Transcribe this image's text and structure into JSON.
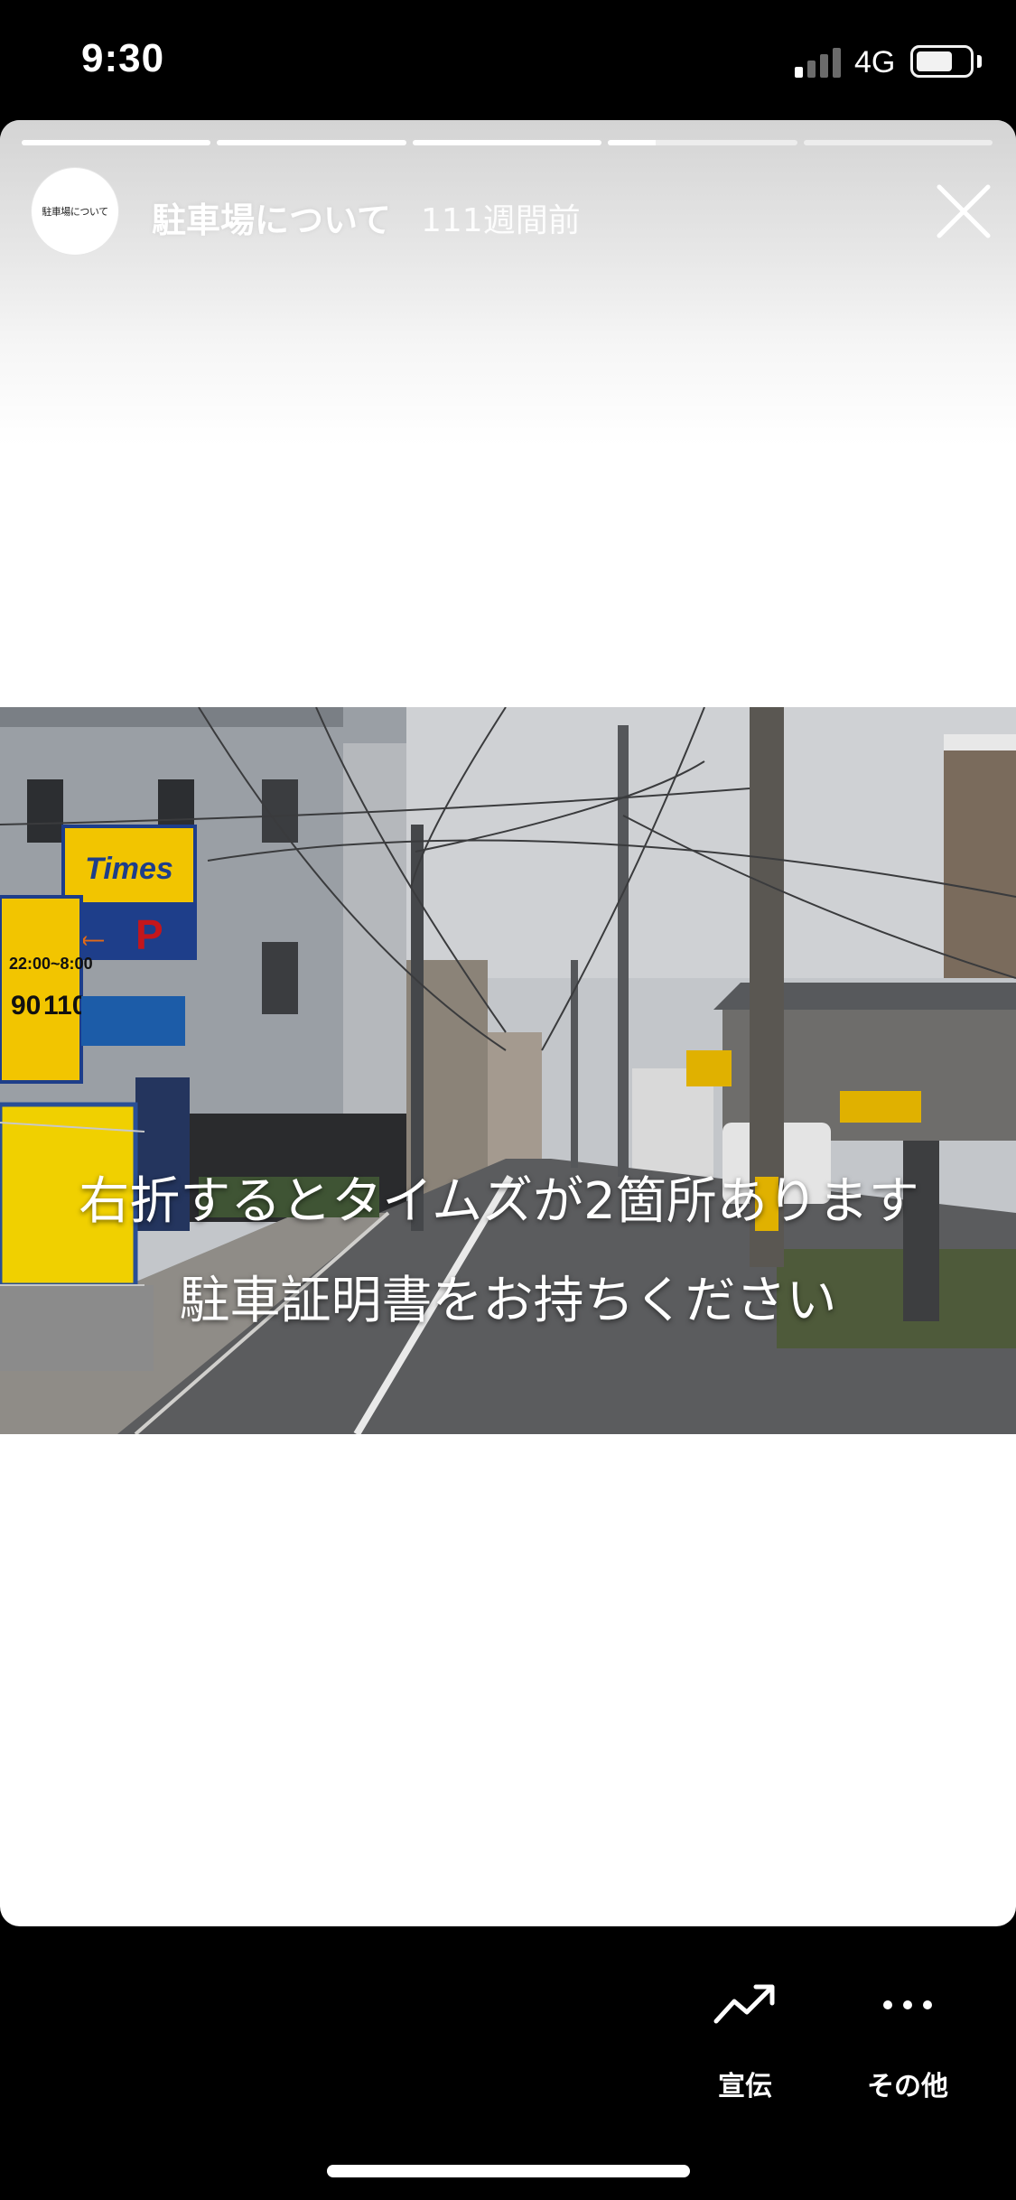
{
  "status_bar": {
    "time": "9:30",
    "network": "4G",
    "signal_bars_filled": 1,
    "battery_level": 0.7
  },
  "story": {
    "segments_total": 5,
    "progress": [
      1,
      1,
      1,
      0.25,
      0
    ],
    "avatar_text": "駐車場について",
    "title": "駐車場について",
    "age": "111週間前",
    "caption_line1": "右折するとタイムズが2箇所あります",
    "caption_line2": "駐車証明書をお持ちください",
    "sign_brand": "Times",
    "sign_hours": "22:00~8:00",
    "sign_price_a": "90",
    "sign_price_b": "110"
  },
  "actions": {
    "promote_label": "宣伝",
    "more_label": "その他"
  },
  "colors": {
    "background": "#000000",
    "card": "#ffffff",
    "sign_yellow": "#f2c500"
  },
  "icons": {
    "close": "close-icon",
    "promote": "trending-up-icon",
    "more": "more-dots-icon"
  }
}
